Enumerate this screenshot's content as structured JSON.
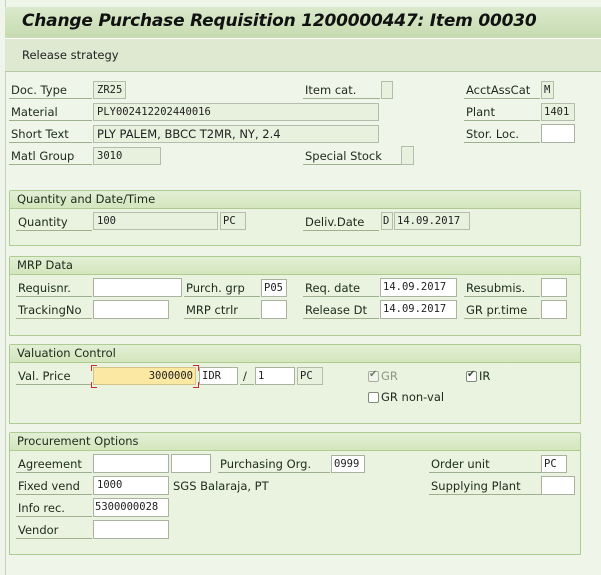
{
  "window": {
    "title": "Change Purchase Requisition 1200000447: Item 00030"
  },
  "toolbar": {
    "release_strategy_label": "Release strategy"
  },
  "header": {
    "doc_type": {
      "label": "Doc. Type",
      "value": "ZR25"
    },
    "item_cat": {
      "label": "Item cat.",
      "value": ""
    },
    "acct_ass_cat": {
      "label": "AcctAssCat",
      "value": "M"
    },
    "material": {
      "label": "Material",
      "value": "PLY002412202440016"
    },
    "plant": {
      "label": "Plant",
      "value": "1401"
    },
    "short_text": {
      "label": "Short Text",
      "value": "PLY PALEM, BBCC T2MR, NY, 2.4"
    },
    "stor_loc": {
      "label": "Stor. Loc.",
      "value": ""
    },
    "matl_group": {
      "label": "Matl Group",
      "value": "3010"
    },
    "special_stock": {
      "label": "Special Stock",
      "value": ""
    }
  },
  "quantity_group": {
    "title": "Quantity and Date/Time",
    "quantity": {
      "label": "Quantity",
      "value": "100",
      "unit": "PC"
    },
    "deliv_date": {
      "label": "Deliv.Date",
      "category": "D",
      "value": "14.09.2017"
    }
  },
  "mrp_group": {
    "title": "MRP Data",
    "requisnr": {
      "label": "Requisnr.",
      "value": ""
    },
    "purch_grp": {
      "label": "Purch. grp",
      "value": "P05"
    },
    "req_date": {
      "label": "Req. date",
      "value": "14.09.2017"
    },
    "resubmis": {
      "label": "Resubmis.",
      "value": ""
    },
    "tracking_no": {
      "label": "TrackingNo",
      "value": ""
    },
    "mrp_ctrlr": {
      "label": "MRP ctrlr",
      "value": ""
    },
    "release_dt": {
      "label": "Release Dt",
      "value": "14.09.2017"
    },
    "gr_pr_time": {
      "label": "GR pr.time",
      "value": ""
    }
  },
  "valuation_group": {
    "title": "Valuation Control",
    "val_price": {
      "label": "Val. Price",
      "value": "3000000",
      "currency": "IDR",
      "separator": "/",
      "per": "1",
      "unit": "PC"
    },
    "gr": {
      "label": "GR",
      "checked": true,
      "disabled": true
    },
    "ir": {
      "label": "IR",
      "checked": true,
      "disabled": false
    },
    "gr_non_val": {
      "label": "GR non-val",
      "checked": false,
      "disabled": false
    }
  },
  "procurement_group": {
    "title": "Procurement Options",
    "agreement": {
      "label": "Agreement",
      "value": "",
      "item": ""
    },
    "purchasing_org": {
      "label": "Purchasing Org.",
      "value": "0999"
    },
    "order_unit": {
      "label": "Order unit",
      "value": "PC"
    },
    "fixed_vend": {
      "label": "Fixed vend",
      "value": "1000",
      "name": "SGS Balaraja, PT"
    },
    "supplying_plant": {
      "label": "Supplying Plant",
      "value": ""
    },
    "info_rec": {
      "label": "Info rec.",
      "value": "5300000028"
    },
    "vendor": {
      "label": "Vendor",
      "value": ""
    }
  }
}
